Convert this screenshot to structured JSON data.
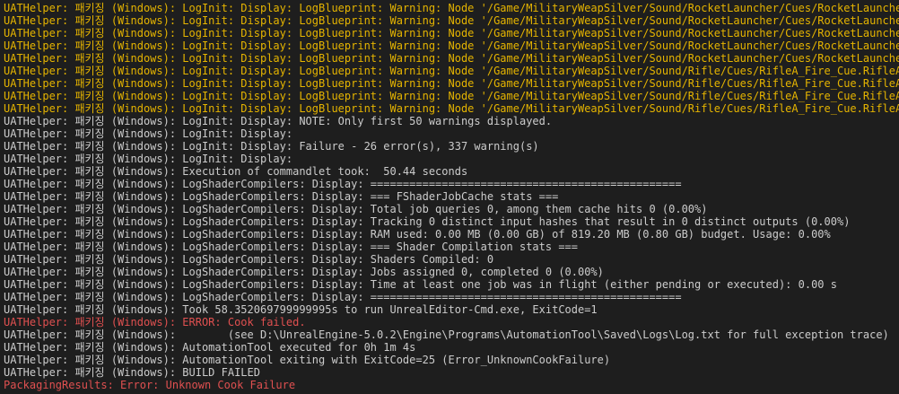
{
  "colors": {
    "background": "#1e1e1e",
    "normal": "#cccccc",
    "warning": "#e5b400",
    "error": "#e05050"
  },
  "console": {
    "lines": [
      {
        "type": "warning",
        "text": "UATHelper: 패키징 (Windows): LogInit: Display: LogBlueprint: Warning: Node '/Game/MilitaryWeapSilver/Sound/RocketLauncher/Cues/RocketLauncher"
      },
      {
        "type": "warning",
        "text": "UATHelper: 패키징 (Windows): LogInit: Display: LogBlueprint: Warning: Node '/Game/MilitaryWeapSilver/Sound/RocketLauncher/Cues/RocketLauncher"
      },
      {
        "type": "warning",
        "text": "UATHelper: 패키징 (Windows): LogInit: Display: LogBlueprint: Warning: Node '/Game/MilitaryWeapSilver/Sound/RocketLauncher/Cues/RocketLauncher"
      },
      {
        "type": "warning",
        "text": "UATHelper: 패키징 (Windows): LogInit: Display: LogBlueprint: Warning: Node '/Game/MilitaryWeapSilver/Sound/RocketLauncher/Cues/RocketLauncher"
      },
      {
        "type": "warning",
        "text": "UATHelper: 패키징 (Windows): LogInit: Display: LogBlueprint: Warning: Node '/Game/MilitaryWeapSilver/Sound/RocketLauncher/Cues/RocketLauncher"
      },
      {
        "type": "warning",
        "text": "UATHelper: 패키징 (Windows): LogInit: Display: LogBlueprint: Warning: Node '/Game/MilitaryWeapSilver/Sound/Rifle/Cues/RifleA_Fire_Cue.RifleA_F"
      },
      {
        "type": "warning",
        "text": "UATHelper: 패키징 (Windows): LogInit: Display: LogBlueprint: Warning: Node '/Game/MilitaryWeapSilver/Sound/Rifle/Cues/RifleA_Fire_Cue.RifleA_F"
      },
      {
        "type": "warning",
        "text": "UATHelper: 패키징 (Windows): LogInit: Display: LogBlueprint: Warning: Node '/Game/MilitaryWeapSilver/Sound/Rifle/Cues/RifleA_Fire_Cue.RifleA_F"
      },
      {
        "type": "warning",
        "text": "UATHelper: 패키징 (Windows): LogInit: Display: LogBlueprint: Warning: Node '/Game/MilitaryWeapSilver/Sound/Rifle/Cues/RifleA_Fire_Cue.RifleA_F"
      },
      {
        "type": "normal",
        "text": "UATHelper: 패키징 (Windows): LogInit: Display: NOTE: Only first 50 warnings displayed."
      },
      {
        "type": "normal",
        "text": "UATHelper: 패키징 (Windows): LogInit: Display:"
      },
      {
        "type": "normal",
        "text": "UATHelper: 패키징 (Windows): LogInit: Display: Failure - 26 error(s), 337 warning(s)"
      },
      {
        "type": "normal",
        "text": "UATHelper: 패키징 (Windows): LogInit: Display:"
      },
      {
        "type": "normal",
        "text": "UATHelper: 패키징 (Windows): Execution of commandlet took:  50.44 seconds"
      },
      {
        "type": "normal",
        "text": "UATHelper: 패키징 (Windows): LogShaderCompilers: Display: ================================================"
      },
      {
        "type": "normal",
        "text": "UATHelper: 패키징 (Windows): LogShaderCompilers: Display: === FShaderJobCache stats ==="
      },
      {
        "type": "normal",
        "text": "UATHelper: 패키징 (Windows): LogShaderCompilers: Display: Total job queries 0, among them cache hits 0 (0.00%)"
      },
      {
        "type": "normal",
        "text": "UATHelper: 패키징 (Windows): LogShaderCompilers: Display: Tracking 0 distinct input hashes that result in 0 distinct outputs (0.00%)"
      },
      {
        "type": "normal",
        "text": "UATHelper: 패키징 (Windows): LogShaderCompilers: Display: RAM used: 0.00 MB (0.00 GB) of 819.20 MB (0.80 GB) budget. Usage: 0.00%"
      },
      {
        "type": "normal",
        "text": "UATHelper: 패키징 (Windows): LogShaderCompilers: Display: === Shader Compilation stats ==="
      },
      {
        "type": "normal",
        "text": "UATHelper: 패키징 (Windows): LogShaderCompilers: Display: Shaders Compiled: 0"
      },
      {
        "type": "normal",
        "text": "UATHelper: 패키징 (Windows): LogShaderCompilers: Display: Jobs assigned 0, completed 0 (0.00%)"
      },
      {
        "type": "normal",
        "text": "UATHelper: 패키징 (Windows): LogShaderCompilers: Display: Time at least one job was in flight (either pending or executed): 0.00 s"
      },
      {
        "type": "normal",
        "text": "UATHelper: 패키징 (Windows): LogShaderCompilers: Display: ================================================"
      },
      {
        "type": "normal",
        "text": "UATHelper: 패키징 (Windows): Took 58.352069799999995s to run UnrealEditor-Cmd.exe, ExitCode=1"
      },
      {
        "type": "error",
        "text": "UATHelper: 패키징 (Windows): ERROR: Cook failed."
      },
      {
        "type": "normal",
        "text": "UATHelper: 패키징 (Windows):        (see D:\\UnrealEngine-5.0.2\\Engine\\Programs\\AutomationTool\\Saved\\Logs\\Log.txt for full exception trace)"
      },
      {
        "type": "normal",
        "text": "UATHelper: 패키징 (Windows): AutomationTool executed for 0h 1m 4s"
      },
      {
        "type": "normal",
        "text": "UATHelper: 패키징 (Windows): AutomationTool exiting with ExitCode=25 (Error_UnknownCookFailure)"
      },
      {
        "type": "normal",
        "text": "UATHelper: 패키징 (Windows): BUILD FAILED"
      },
      {
        "type": "pkg-error",
        "text": "PackagingResults: Error: Unknown Cook Failure"
      }
    ]
  }
}
